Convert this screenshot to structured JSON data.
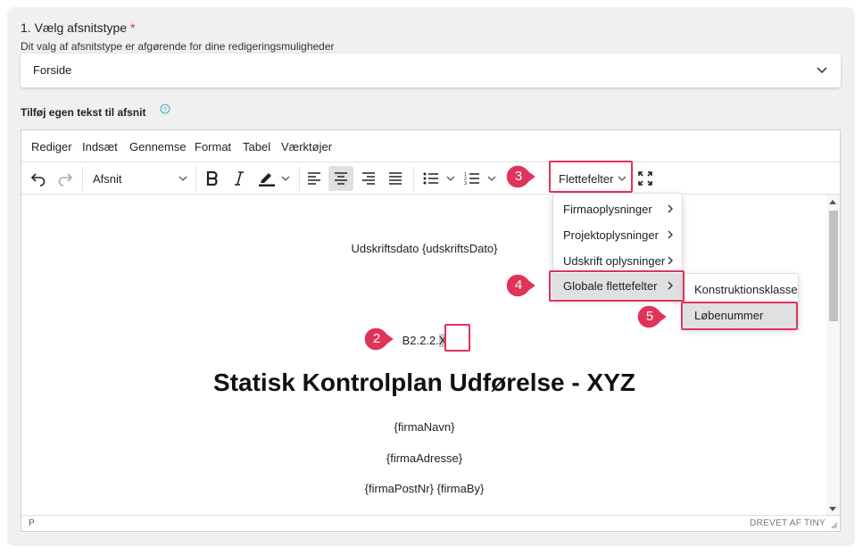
{
  "section": {
    "title": "1. Vælg afsnitstype",
    "required_mark": "*",
    "subtitle": "Dit valg af afsnitstype er afgørende for dine redigeringsmuligheder",
    "select_value": "Forside"
  },
  "custom_text": {
    "label": "Tilføj egen tekst til afsnit"
  },
  "menubar": [
    "Rediger",
    "Indsæt",
    "Gennemse",
    "Format",
    "Tabel",
    "Værktøjer"
  ],
  "toolbar": {
    "block_format": "Afsnit",
    "merge_fields": "Flettefelter"
  },
  "content": {
    "print_date": "Udskriftsdato {udskriftsDato}",
    "code": "B2.2.2.",
    "code_selected": "X",
    "heading": "Statisk Kontrolplan Udførelse - XYZ",
    "company_name": "{firmaNavn}",
    "company_address": "{firmaAdresse}",
    "company_postal": "{firmaPostNr} {firmaBy}"
  },
  "statusbar": {
    "path": "P",
    "brand": "DREVET AF TINY"
  },
  "dropdown": {
    "items": [
      "Firmaoplysninger",
      "Projektoplysninger",
      "Udskrift oplysninger",
      "Globale flettefelter"
    ]
  },
  "submenu": {
    "items": [
      "Konstruktionsklasse",
      "Løbenummer"
    ]
  },
  "badges": [
    "2",
    "3",
    "4",
    "5"
  ],
  "colors": {
    "highlight": "#e0335a",
    "required": "#d32f2f",
    "active_bg": "#dee0e2"
  }
}
